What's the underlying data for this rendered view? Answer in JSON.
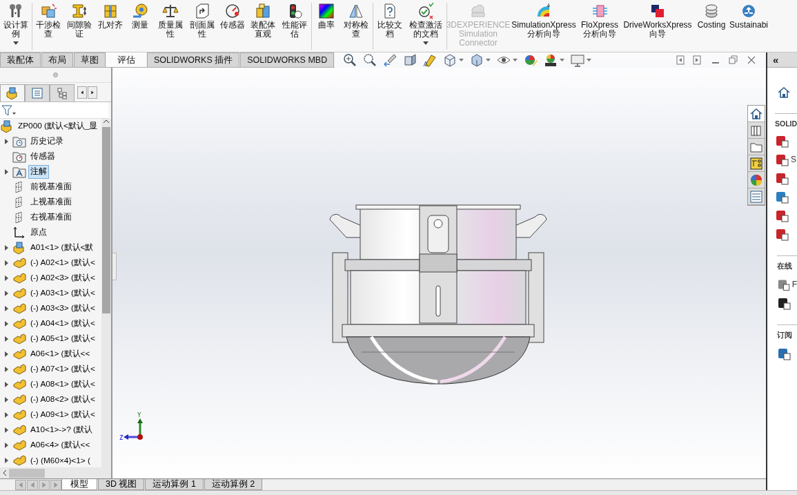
{
  "ribbon": {
    "groups": [
      {
        "items": [
          {
            "label": "设计算例",
            "dropdown": true,
            "disabled": false
          }
        ]
      },
      {
        "items": [
          {
            "label": "干涉检查",
            "dropdown": false,
            "disabled": false
          },
          {
            "label": "间隙验证",
            "dropdown": false,
            "disabled": false
          },
          {
            "label": "孔对齐",
            "dropdown": false,
            "disabled": false
          },
          {
            "label": "测量",
            "dropdown": false,
            "disabled": false
          },
          {
            "label": "质量属性",
            "dropdown": false,
            "disabled": false
          },
          {
            "label": "剖面属性",
            "dropdown": false,
            "disabled": false
          },
          {
            "label": "传感器",
            "dropdown": false,
            "disabled": false
          },
          {
            "label": "装配体直观",
            "dropdown": false,
            "disabled": false
          },
          {
            "label": "性能评估",
            "dropdown": false,
            "disabled": false
          }
        ]
      },
      {
        "items": [
          {
            "label": "曲率",
            "dropdown": false,
            "disabled": false
          },
          {
            "label": "对称检查",
            "dropdown": false,
            "disabled": false
          }
        ]
      },
      {
        "items": [
          {
            "label": "比较文档",
            "dropdown": false,
            "disabled": false
          },
          {
            "label": "检查激活的文档",
            "dropdown": true,
            "disabled": false
          }
        ]
      },
      {
        "items": [
          {
            "label": "3DEXPERIENCE Simulation Connector",
            "dropdown": false,
            "disabled": true
          },
          {
            "label": "SimulationXpress 分析向导",
            "dropdown": false,
            "disabled": false
          },
          {
            "label": "FloXpress 分析向导",
            "dropdown": false,
            "disabled": false
          },
          {
            "label": "DriveWorksXpress 向导",
            "dropdown": false,
            "disabled": false
          },
          {
            "label": "Costing",
            "dropdown": false,
            "disabled": false
          },
          {
            "label": "Sustainabi",
            "dropdown": false,
            "disabled": false
          }
        ]
      }
    ]
  },
  "command_tabs": [
    {
      "label": "装配体",
      "selected": false
    },
    {
      "label": "布局",
      "selected": false
    },
    {
      "label": "草图",
      "selected": false
    },
    {
      "label": "评估",
      "selected": true
    },
    {
      "label": "SOLIDWORKS 插件",
      "selected": false
    },
    {
      "label": "SOLIDWORKS MBD",
      "selected": false
    }
  ],
  "feature_tree": {
    "root": {
      "label": "ZP000  (默认<默认_显",
      "kind": "assembly",
      "children": [
        {
          "label": "历史记录",
          "kind": "history",
          "expandable": true,
          "selected": false
        },
        {
          "label": "传感器",
          "kind": "sensors",
          "expandable": false,
          "selected": false
        },
        {
          "label": "注解",
          "kind": "annotations",
          "expandable": true,
          "selected": true
        },
        {
          "label": "前视基准面",
          "kind": "plane",
          "expandable": false,
          "selected": false
        },
        {
          "label": "上视基准面",
          "kind": "plane",
          "expandable": false,
          "selected": false
        },
        {
          "label": "右视基准面",
          "kind": "plane",
          "expandable": false,
          "selected": false
        },
        {
          "label": "原点",
          "kind": "origin",
          "expandable": false,
          "selected": false
        },
        {
          "label": "A01<1>  (默认<默",
          "kind": "assembly",
          "expandable": true,
          "selected": false
        },
        {
          "label": "(-) A02<1>  (默认<",
          "kind": "part",
          "expandable": true,
          "selected": false
        },
        {
          "label": "(-) A02<3>  (默认<",
          "kind": "part",
          "expandable": true,
          "selected": false
        },
        {
          "label": "(-) A03<1>  (默认<",
          "kind": "part",
          "expandable": true,
          "selected": false
        },
        {
          "label": "(-) A03<3>  (默认<",
          "kind": "part",
          "expandable": true,
          "selected": false
        },
        {
          "label": "(-) A04<1>  (默认<",
          "kind": "part",
          "expandable": true,
          "selected": false
        },
        {
          "label": "(-) A05<1>  (默认<",
          "kind": "part",
          "expandable": true,
          "selected": false
        },
        {
          "label": "A06<1>  (默认<<",
          "kind": "part",
          "expandable": true,
          "selected": false
        },
        {
          "label": "(-) A07<1>  (默认<",
          "kind": "part",
          "expandable": true,
          "selected": false
        },
        {
          "label": "(-) A08<1>  (默认<",
          "kind": "part",
          "expandable": true,
          "selected": false
        },
        {
          "label": "(-) A08<2>  (默认<",
          "kind": "part",
          "expandable": true,
          "selected": false
        },
        {
          "label": "(-) A09<1>  (默认<",
          "kind": "part",
          "expandable": true,
          "selected": false
        },
        {
          "label": "A10<1>->?  (默认",
          "kind": "part",
          "expandable": true,
          "selected": false
        },
        {
          "label": "A06<4>  (默认<<",
          "kind": "part",
          "expandable": true,
          "selected": false
        },
        {
          "label": "(-) (M60×4)<1>  (",
          "kind": "part",
          "expandable": true,
          "selected": false
        }
      ]
    }
  },
  "triad": {
    "y_label": "Y",
    "z_label": "Z"
  },
  "task_pane": {
    "collapse_glyph": "«",
    "sections": [
      {
        "heading": "SOLID",
        "links": [
          "S"
        ]
      },
      {
        "heading": "在线",
        "links": [
          "F"
        ]
      },
      {
        "heading": "订阅"
      }
    ]
  },
  "feature_manager_tabs": [
    {
      "selected": true
    },
    {
      "selected": false
    },
    {
      "selected": false
    }
  ],
  "task_tabs": [
    {
      "selected": true
    },
    {
      "selected": false
    },
    {
      "selected": false
    },
    {
      "selected": false
    },
    {
      "selected": false
    },
    {
      "selected": false
    }
  ],
  "model_tabs": [
    {
      "label": "模型",
      "selected": true
    },
    {
      "label": "3D 视图",
      "selected": false
    },
    {
      "label": "运动算例 1",
      "selected": false
    },
    {
      "label": "运动算例 2",
      "selected": false
    }
  ]
}
